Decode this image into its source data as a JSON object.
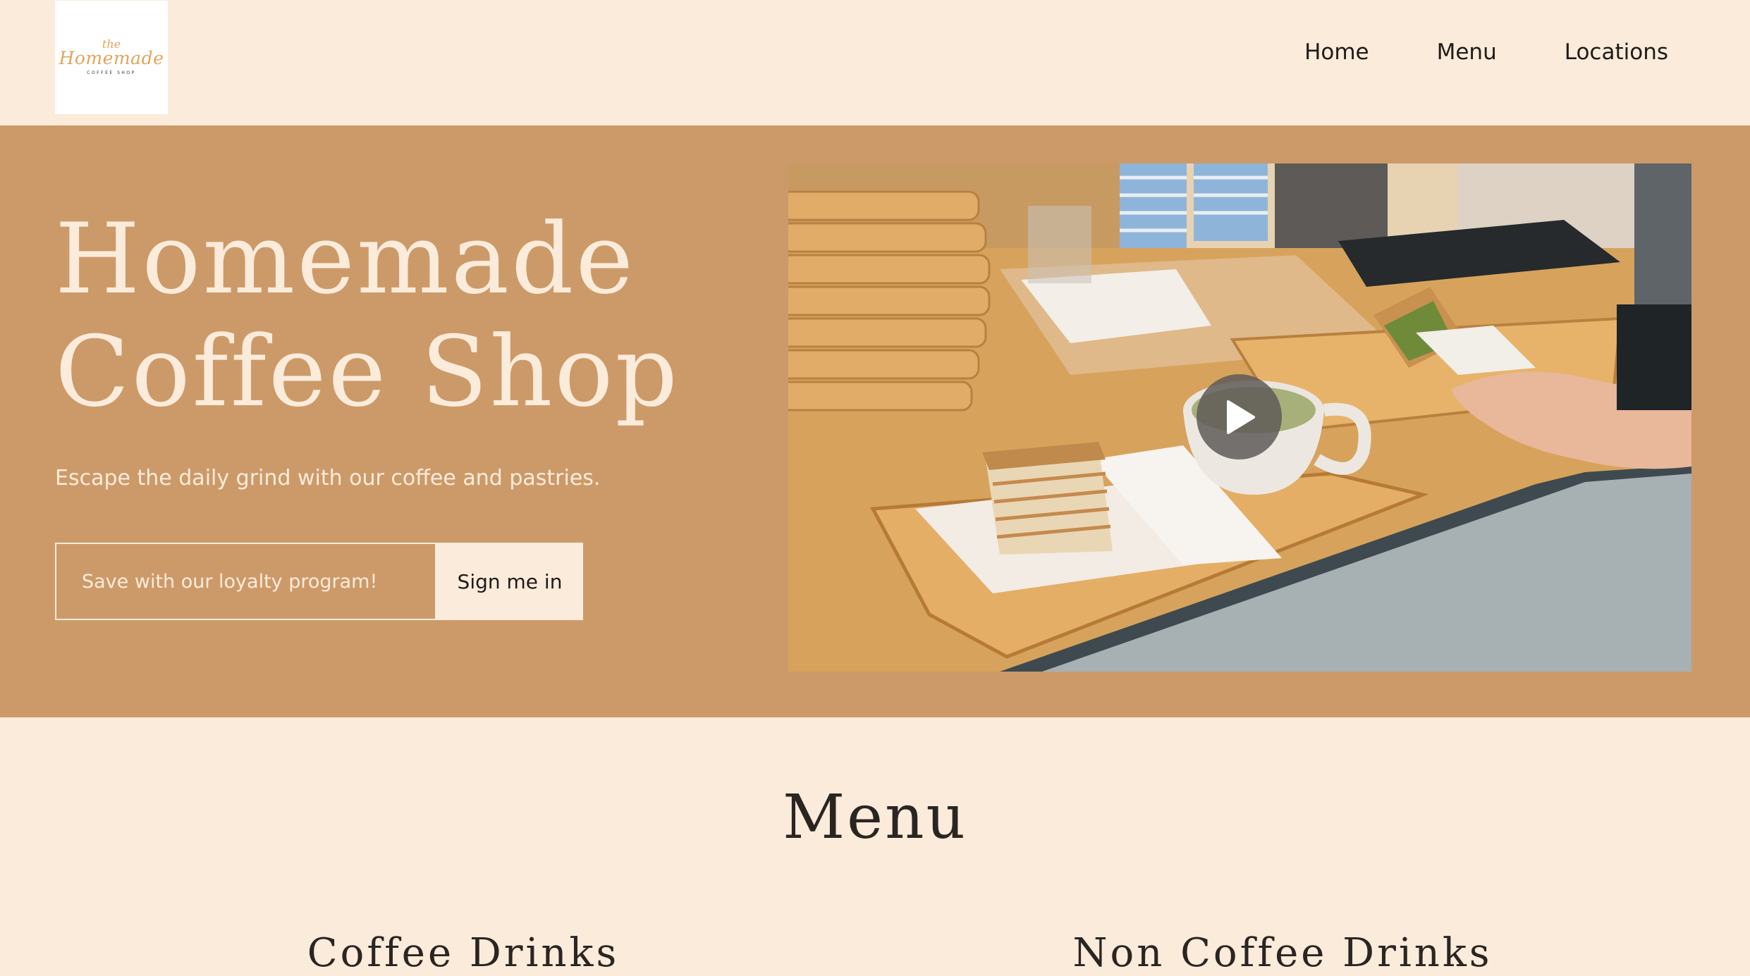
{
  "logo": {
    "small": "the",
    "main": "Homemade",
    "sub": "COFFEE SHOP"
  },
  "nav": {
    "items": [
      "Home",
      "Menu",
      "Locations"
    ]
  },
  "hero": {
    "title_line1": "Homemade",
    "title_line2": "Coffee Shop",
    "subtitle": "Escape the daily grind with our coffee and pastries.",
    "signup_placeholder": "Save with our loyalty program!",
    "signup_button": "Sign me in"
  },
  "menu": {
    "title": "Menu",
    "categories": [
      "Coffee Drinks",
      "Non Coffee Drinks"
    ]
  },
  "colors": {
    "cream": "#fbebdb",
    "caramel": "#cc9a69",
    "text_dark": "#2b2522",
    "logo_gold": "#e2a45c"
  },
  "icons": {
    "video_play": "play-icon"
  }
}
